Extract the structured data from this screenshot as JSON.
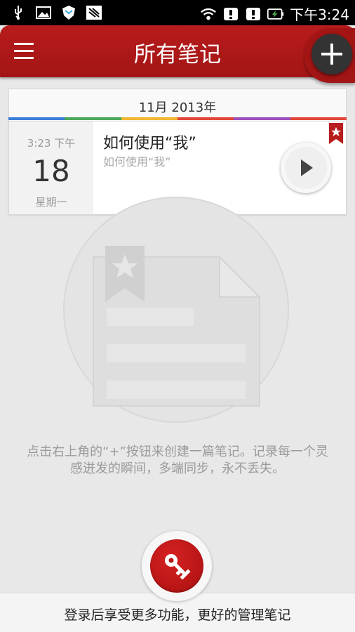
{
  "status_bar": {
    "time": "下午3:24",
    "icons": [
      "usb-icon",
      "image-icon",
      "shield-icon",
      "app-icon",
      "wifi-icon",
      "alert-icon",
      "alert-icon",
      "battery-charging-icon"
    ]
  },
  "header": {
    "title": "所有笔记",
    "menu_icon": "menu-icon",
    "add_icon": "plus-icon",
    "accent": "#b01a1a"
  },
  "notes": {
    "month_label": "11月 2013年",
    "rainbow_colors": [
      "#3b7fd6",
      "#4aa95a",
      "#f2b632",
      "#e1473a",
      "#9b4fbd",
      "#e1473a"
    ],
    "items": [
      {
        "time": "3:23 下午",
        "day": "18",
        "weekday": "星期一",
        "title": "如何使用“我”",
        "snippet": "如何使用“我”"
      }
    ]
  },
  "empty_state": {
    "hint": "点击右上角的“+”按钮来创建一篇笔记。记录每一个灵感迸发的瞬间，多端同步，永不丢失。"
  },
  "login": {
    "label": "登录后享受更多功能，更好的管理笔记",
    "icon": "key-icon"
  }
}
